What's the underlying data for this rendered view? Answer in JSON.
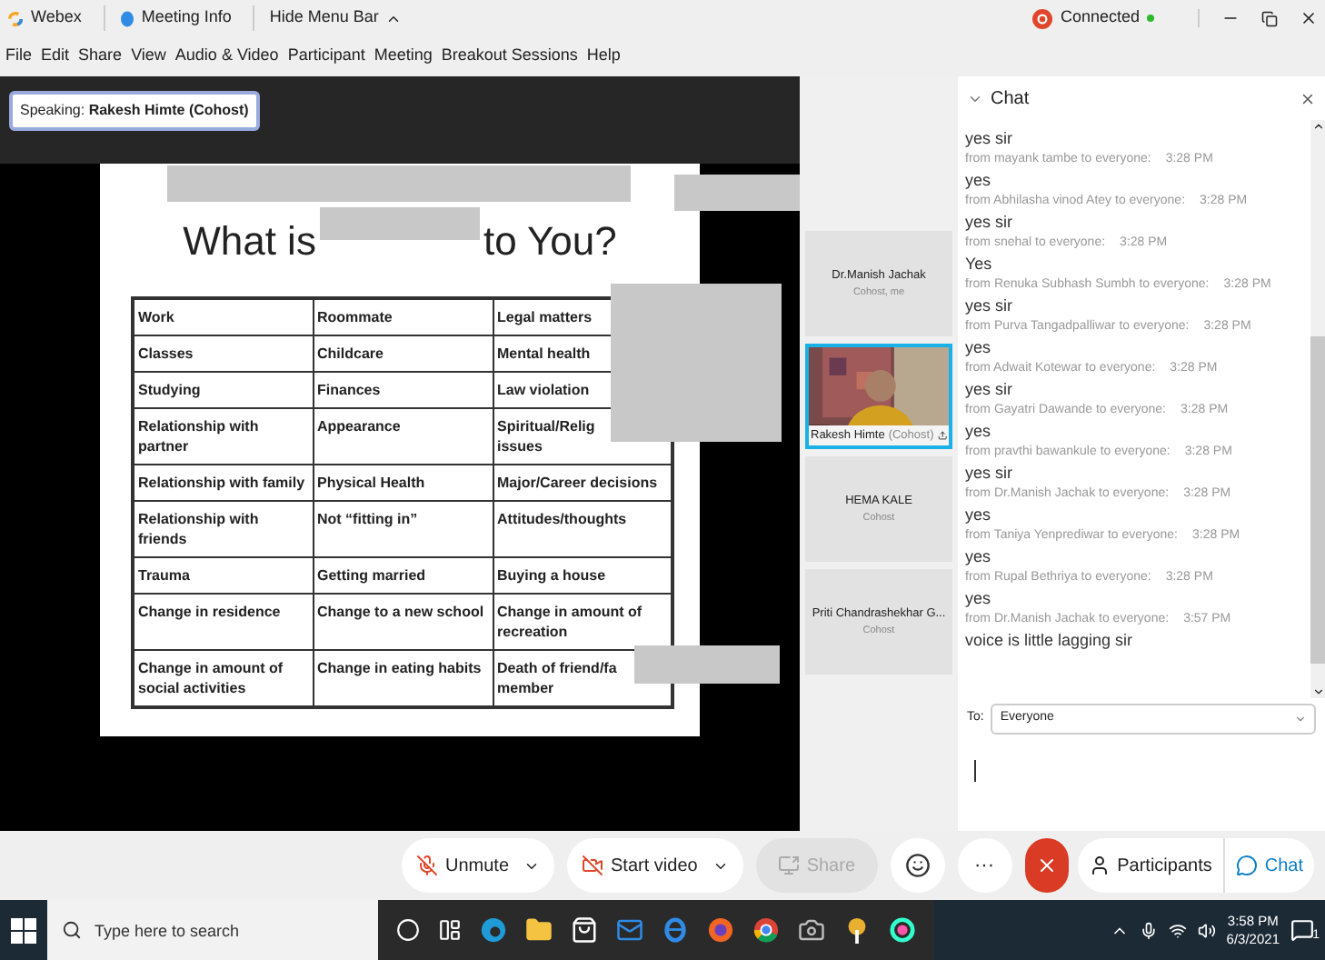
{
  "title_bar": {
    "app": "Webex",
    "meeting_info": "Meeting Info",
    "hide_menu": "Hide Menu Bar",
    "status": "Connected"
  },
  "menu": [
    "File",
    "Edit",
    "Share",
    "View",
    "Audio & Video",
    "Participant",
    "Meeting",
    "Breakout Sessions",
    "Help"
  ],
  "speaking": "Speaking: **Rakesh Himte (Cohost)**",
  "slide": {
    "title_start": "What is",
    "title_end": "to You?",
    "rows": [
      [
        "Work",
        "Roommate",
        "Legal matters"
      ],
      [
        "Classes",
        "Childcare",
        "Mental health"
      ],
      [
        "Studying",
        "Finances",
        "Law violation"
      ],
      [
        "Relationship with partner",
        "Appearance",
        "Spiritual/Relig\nissues"
      ],
      [
        "Relationship with family",
        "Physical Health",
        "Major/Career decisions"
      ],
      [
        "Relationship with friends",
        "Not “fitting in”",
        "Attitudes/thoughts"
      ],
      [
        "Trauma",
        "Getting married",
        "Buying a house"
      ],
      [
        "Change in residence",
        "Change to a new school",
        "Change in amount of recreation"
      ],
      [
        "Change in amount of social activities",
        "Change in eating habits",
        "Death of friend/fa\nmember"
      ]
    ]
  },
  "participants": [
    {
      "kind": "placeholder",
      "name": "Dr.Manish Jachak",
      "role": "Cohost, me",
      "selected": false
    },
    {
      "kind": "video",
      "name": "Rakesh Himte",
      "role": "(Cohost)",
      "selected": true
    },
    {
      "kind": "placeholder",
      "name": "HEMA KALE",
      "role": "Cohost",
      "selected": false
    },
    {
      "kind": "placeholder",
      "name": "Priti Chandrashekhar G...",
      "role": "Cohost",
      "selected": false
    }
  ],
  "chat": {
    "title": "Chat",
    "messages": [
      {
        "text": "yes sir",
        "meta": "from mayank tambe to everyone:",
        "time": "3:28 PM"
      },
      {
        "text": "yes",
        "meta": "from Abhilasha vinod Atey to everyone:",
        "time": "3:28 PM"
      },
      {
        "text": "yes sir",
        "meta": "from snehal to everyone:",
        "time": "3:28 PM"
      },
      {
        "text": "Yes",
        "meta": "from Renuka Subhash Sumbh to everyone:",
        "time": "3:28 PM"
      },
      {
        "text": "yes sir",
        "meta": "from Purva Tangadpalliwar to everyone:",
        "time": "3:28 PM"
      },
      {
        "text": "yes",
        "meta": "from Adwait Kotewar to everyone:",
        "time": "3:28 PM"
      },
      {
        "text": "yes sir",
        "meta": "from Gayatri Dawande to everyone:",
        "time": "3:28 PM"
      },
      {
        "text": "yes",
        "meta": "from pravthi bawankule to everyone:",
        "time": "3:28 PM"
      },
      {
        "text": "yes sir",
        "meta": "from Dr.Manish Jachak to everyone:",
        "time": "3:28 PM"
      },
      {
        "text": "yes",
        "meta": "from Taniya Yenprediwar to everyone:",
        "time": "3:28 PM"
      },
      {
        "text": "yes",
        "meta": "from Rupal Bethriya to everyone:",
        "time": "3:28 PM"
      },
      {
        "text": "yes",
        "meta": "from Dr.Manish Jachak to everyone:",
        "time": "3:57 PM"
      },
      {
        "text": "voice is little lagging sir"
      }
    ],
    "to_label": "To:",
    "recipient": "Everyone"
  },
  "controls": [
    {
      "kind": "unmute",
      "label": "Unmute",
      "disabled": false
    },
    {
      "kind": "video",
      "label": "Start video",
      "disabled": false
    },
    {
      "kind": "share",
      "label": "Share",
      "disabled": true
    },
    {
      "kind": "reactions"
    },
    {
      "kind": "more",
      "label": "···"
    },
    {
      "kind": "leave"
    }
  ],
  "side_tabs": [
    {
      "label": "Participants",
      "selected": false
    },
    {
      "label": "Chat",
      "selected": true
    }
  ],
  "taskbar": {
    "search_placeholder": "Type here to search",
    "time": "3:58 PM",
    "date": "6/3/2021",
    "notifications": "1"
  }
}
